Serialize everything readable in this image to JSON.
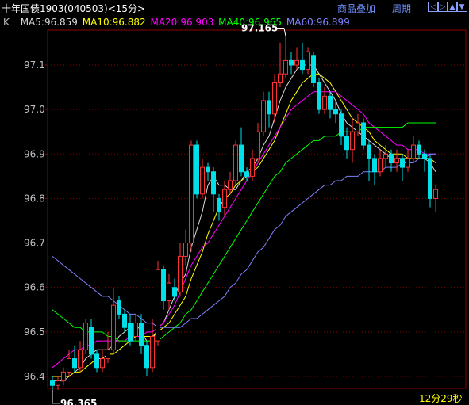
{
  "header": {
    "title": "十年国债1903(040503)<15分>",
    "link_overlay": "商品叠加",
    "link_period": "周期",
    "nav_buttons": [
      {
        "icon": "arrow-left-icon",
        "glyph": "◁"
      },
      {
        "icon": "arrow-right-icon",
        "glyph": "▷"
      },
      {
        "icon": "zoom-in-icon",
        "glyph": "▲"
      },
      {
        "icon": "zoom-out-icon",
        "glyph": "▼"
      }
    ]
  },
  "legend": {
    "k_label": "K",
    "items": [
      {
        "text": "MA5:96.859",
        "color": "#d8d8d8"
      },
      {
        "text": "MA10:96.882",
        "color": "#ffff00"
      },
      {
        "text": "MA20:96.903",
        "color": "#ff00ff"
      },
      {
        "text": "MA40:96.965",
        "color": "#00ff00"
      },
      {
        "text": "MA60:96.899",
        "color": "#8080ff"
      }
    ]
  },
  "footer": {
    "timer": "12分29秒"
  },
  "chart_data": {
    "type": "candlestick",
    "ylim": [
      96.38,
      97.22
    ],
    "yticks": [
      "97.1",
      "97.0",
      "96.9",
      "96.8",
      "96.7",
      "96.6",
      "96.5",
      "96.4"
    ],
    "max_label": "97.165",
    "min_label": "96.365",
    "colors": {
      "up": "#ff3232",
      "down": "#00e0e8",
      "grid": "#8b0000",
      "text": "#c0c0c0"
    },
    "candles": [
      [
        96.39,
        96.38,
        96.4,
        96.37
      ],
      [
        96.38,
        96.39,
        96.4,
        96.37
      ],
      [
        96.39,
        96.41,
        96.42,
        96.38
      ],
      [
        96.41,
        96.44,
        96.46,
        96.4
      ],
      [
        96.44,
        96.42,
        96.47,
        96.41
      ],
      [
        96.42,
        96.46,
        96.48,
        96.41
      ],
      [
        96.46,
        96.52,
        96.53,
        96.45
      ],
      [
        96.51,
        96.45,
        96.53,
        96.44
      ],
      [
        96.45,
        96.42,
        96.46,
        96.41
      ],
      [
        96.42,
        96.44,
        96.46,
        96.41
      ],
      [
        96.44,
        96.46,
        96.5,
        96.43
      ],
      [
        96.46,
        96.56,
        96.6,
        96.45
      ],
      [
        96.57,
        96.54,
        96.58,
        96.53
      ],
      [
        96.54,
        96.51,
        96.55,
        96.5
      ],
      [
        96.52,
        96.48,
        96.54,
        96.47
      ],
      [
        96.49,
        96.52,
        96.54,
        96.48
      ],
      [
        96.52,
        96.47,
        96.54,
        96.45
      ],
      [
        96.47,
        96.42,
        96.48,
        96.4
      ],
      [
        96.42,
        96.49,
        96.53,
        96.41
      ],
      [
        96.48,
        96.64,
        96.66,
        96.47
      ],
      [
        96.64,
        96.57,
        96.65,
        96.55
      ],
      [
        96.57,
        96.61,
        96.63,
        96.55
      ],
      [
        96.6,
        96.58,
        96.62,
        96.57
      ],
      [
        96.59,
        96.67,
        96.7,
        96.58
      ],
      [
        96.67,
        96.7,
        96.73,
        96.65
      ],
      [
        96.7,
        96.92,
        96.93,
        96.68
      ],
      [
        96.92,
        96.81,
        96.93,
        96.8
      ],
      [
        96.81,
        96.87,
        96.89,
        96.8
      ],
      [
        96.87,
        96.86,
        96.88,
        96.84
      ],
      [
        96.86,
        96.81,
        96.87,
        96.77
      ],
      [
        96.8,
        96.77,
        96.81,
        96.75
      ],
      [
        96.78,
        96.82,
        96.84,
        96.76
      ],
      [
        96.82,
        96.84,
        96.86,
        96.81
      ],
      [
        96.84,
        96.92,
        96.93,
        96.83
      ],
      [
        96.92,
        96.86,
        96.96,
        96.85
      ],
      [
        96.86,
        96.85,
        96.87,
        96.84
      ],
      [
        96.85,
        96.89,
        96.91,
        96.84
      ],
      [
        96.89,
        96.95,
        96.97,
        96.88
      ],
      [
        96.95,
        97.02,
        97.04,
        96.94
      ],
      [
        97.02,
        96.99,
        97.04,
        96.96
      ],
      [
        96.99,
        97.06,
        97.08,
        96.97
      ],
      [
        97.06,
        97.08,
        97.15,
        97.05
      ],
      [
        97.08,
        97.11,
        97.165,
        97.07
      ],
      [
        97.11,
        97.1,
        97.13,
        97.08
      ],
      [
        97.1,
        97.11,
        97.14,
        97.09
      ],
      [
        97.11,
        97.09,
        97.15,
        97.08
      ],
      [
        97.09,
        97.13,
        97.14,
        97.08
      ],
      [
        97.12,
        97.06,
        97.13,
        97.05
      ],
      [
        97.06,
        97.0,
        97.07,
        96.99
      ],
      [
        97.0,
        97.03,
        97.05,
        96.99
      ],
      [
        97.03,
        97.0,
        97.04,
        96.98
      ],
      [
        97.0,
        96.99,
        97.02,
        96.97
      ],
      [
        96.99,
        96.94,
        97.0,
        96.92
      ],
      [
        96.94,
        96.91,
        96.96,
        96.89
      ],
      [
        96.91,
        96.95,
        96.98,
        96.88
      ],
      [
        96.95,
        96.97,
        96.99,
        96.94
      ],
      [
        96.97,
        96.92,
        96.98,
        96.91
      ],
      [
        96.92,
        96.89,
        96.93,
        96.84
      ],
      [
        96.89,
        96.86,
        96.9,
        96.83
      ],
      [
        96.86,
        96.89,
        96.91,
        96.85
      ],
      [
        96.89,
        96.9,
        96.92,
        96.87
      ],
      [
        96.9,
        96.88,
        96.91,
        96.86
      ],
      [
        96.88,
        96.89,
        96.91,
        96.86
      ],
      [
        96.89,
        96.87,
        96.9,
        96.84
      ],
      [
        96.87,
        96.89,
        96.91,
        96.86
      ],
      [
        96.89,
        96.92,
        96.94,
        96.88
      ],
      [
        96.92,
        96.9,
        96.93,
        96.89
      ],
      [
        96.9,
        96.89,
        96.91,
        96.86
      ],
      [
        96.89,
        96.8,
        96.9,
        96.78
      ],
      [
        96.8,
        96.82,
        96.83,
        96.77
      ]
    ],
    "ma": [
      {
        "name": "MA5",
        "color": "#d8d8d8",
        "values": [
          96.39,
          96.39,
          96.39,
          96.4,
          96.41,
          96.42,
          96.44,
          96.45,
          96.46,
          96.46,
          96.46,
          96.47,
          96.49,
          96.5,
          96.51,
          96.52,
          96.5,
          96.48,
          96.48,
          96.51,
          96.52,
          96.55,
          96.58,
          96.61,
          96.63,
          96.69,
          96.73,
          96.77,
          96.83,
          96.85,
          96.83,
          96.83,
          96.82,
          96.82,
          96.84,
          96.86,
          96.87,
          96.89,
          96.92,
          96.94,
          96.98,
          97.02,
          97.05,
          97.07,
          97.09,
          97.1,
          97.1,
          97.1,
          97.08,
          97.06,
          97.04,
          97.02,
          96.99,
          96.97,
          96.96,
          96.95,
          96.94,
          96.93,
          96.92,
          96.91,
          96.9,
          96.89,
          96.89,
          96.89,
          96.89,
          96.89,
          96.89,
          96.89,
          96.88,
          96.86
        ]
      },
      {
        "name": "MA10",
        "color": "#ffff00",
        "values": [
          96.4,
          96.4,
          96.4,
          96.4,
          96.41,
          96.41,
          96.42,
          96.43,
          96.44,
          96.44,
          96.45,
          96.45,
          96.46,
          96.47,
          96.48,
          96.49,
          96.49,
          96.49,
          96.49,
          96.5,
          96.51,
          96.52,
          96.54,
          96.56,
          96.58,
          96.62,
          96.65,
          96.68,
          96.72,
          96.75,
          96.78,
          96.8,
          96.81,
          96.83,
          96.84,
          96.85,
          96.86,
          96.87,
          96.89,
          96.91,
          96.93,
          96.96,
          96.99,
          97.02,
          97.04,
          97.06,
          97.07,
          97.08,
          97.08,
          97.07,
          97.06,
          97.04,
          97.02,
          97.0,
          96.98,
          96.97,
          96.96,
          96.95,
          96.93,
          96.92,
          96.91,
          96.9,
          96.9,
          96.9,
          96.89,
          96.89,
          96.89,
          96.89,
          96.89,
          96.88
        ]
      },
      {
        "name": "MA20",
        "color": "#ff00ff",
        "values": [
          96.42,
          96.43,
          96.44,
          96.45,
          96.46,
          96.46,
          96.47,
          96.47,
          96.48,
          96.48,
          96.48,
          96.48,
          96.48,
          96.48,
          96.49,
          96.49,
          96.49,
          96.5,
          96.5,
          96.51,
          96.52,
          96.54,
          96.56,
          96.59,
          96.62,
          96.65,
          96.67,
          96.69,
          96.7,
          96.72,
          96.74,
          96.76,
          96.78,
          96.8,
          96.82,
          96.84,
          96.86,
          96.88,
          96.9,
          96.92,
          96.94,
          96.96,
          96.98,
          97.0,
          97.01,
          97.02,
          97.03,
          97.04,
          97.04,
          97.04,
          97.04,
          97.04,
          97.03,
          97.02,
          97.01,
          97.0,
          96.99,
          96.97,
          96.96,
          96.95,
          96.94,
          96.93,
          96.92,
          96.92,
          96.91,
          96.91,
          96.91,
          96.9,
          96.9,
          96.9
        ]
      },
      {
        "name": "MA40",
        "color": "#00ff00",
        "values": [
          96.55,
          96.54,
          96.53,
          96.52,
          96.51,
          96.51,
          96.5,
          96.5,
          96.5,
          96.5,
          96.49,
          96.49,
          96.48,
          96.48,
          96.48,
          96.48,
          96.48,
          96.48,
          96.48,
          96.48,
          96.49,
          96.5,
          96.51,
          96.52,
          96.54,
          96.55,
          96.57,
          96.59,
          96.61,
          96.63,
          96.65,
          96.67,
          96.69,
          96.71,
          96.73,
          96.75,
          96.77,
          96.79,
          96.81,
          96.83,
          96.85,
          96.86,
          96.88,
          96.89,
          96.9,
          96.91,
          96.92,
          96.93,
          96.93,
          96.94,
          96.94,
          96.94,
          96.95,
          96.95,
          96.95,
          96.95,
          96.96,
          96.96,
          96.96,
          96.96,
          96.96,
          96.96,
          96.96,
          96.96,
          96.97,
          96.97,
          96.97,
          96.97,
          96.97,
          96.97
        ]
      },
      {
        "name": "MA60",
        "color": "#8080ff",
        "values": [
          96.67,
          96.66,
          96.65,
          96.64,
          96.63,
          96.62,
          96.61,
          96.6,
          96.59,
          96.58,
          96.58,
          96.57,
          96.56,
          96.55,
          96.54,
          96.54,
          96.53,
          96.52,
          96.52,
          96.51,
          96.51,
          96.51,
          96.51,
          96.51,
          96.52,
          96.53,
          96.53,
          96.54,
          96.55,
          96.56,
          96.57,
          96.58,
          96.6,
          96.61,
          96.63,
          96.64,
          96.66,
          96.68,
          96.69,
          96.71,
          96.73,
          96.74,
          96.76,
          96.77,
          96.78,
          96.79,
          96.8,
          96.81,
          96.82,
          96.83,
          96.83,
          96.84,
          96.84,
          96.85,
          96.85,
          96.85,
          96.86,
          96.86,
          96.86,
          96.86,
          96.87,
          96.87,
          96.87,
          96.88,
          96.88,
          96.88,
          96.89,
          96.89,
          96.9,
          96.9
        ]
      }
    ]
  }
}
